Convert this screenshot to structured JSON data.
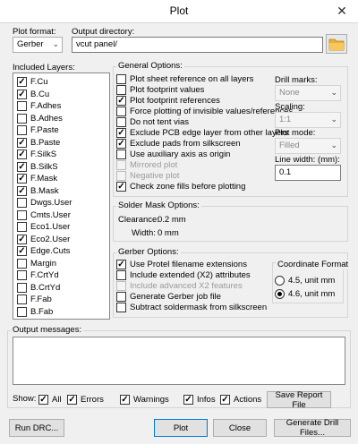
{
  "window": {
    "title": "Plot",
    "close_glyph": "✕"
  },
  "plot_format": {
    "label": "Plot format:",
    "value": "Gerber"
  },
  "output_directory": {
    "label": "Output directory:",
    "value": "vcut panel/",
    "folder_icon": "folder-icon"
  },
  "layers": {
    "label": "Included Layers:",
    "items": [
      {
        "name": "F.Cu",
        "checked": true
      },
      {
        "name": "B.Cu",
        "checked": true
      },
      {
        "name": "F.Adhes",
        "checked": false
      },
      {
        "name": "B.Adhes",
        "checked": false
      },
      {
        "name": "F.Paste",
        "checked": false
      },
      {
        "name": "B.Paste",
        "checked": true
      },
      {
        "name": "F.SilkS",
        "checked": true
      },
      {
        "name": "B.SilkS",
        "checked": true
      },
      {
        "name": "F.Mask",
        "checked": true
      },
      {
        "name": "B.Mask",
        "checked": true
      },
      {
        "name": "Dwgs.User",
        "checked": false
      },
      {
        "name": "Cmts.User",
        "checked": false
      },
      {
        "name": "Eco1.User",
        "checked": false
      },
      {
        "name": "Eco2.User",
        "checked": true
      },
      {
        "name": "Edge.Cuts",
        "checked": true
      },
      {
        "name": "Margin",
        "checked": false
      },
      {
        "name": "F.CrtYd",
        "checked": false
      },
      {
        "name": "B.CrtYd",
        "checked": false
      },
      {
        "name": "F.Fab",
        "checked": false
      },
      {
        "name": "B.Fab",
        "checked": false
      }
    ]
  },
  "general": {
    "label": "General Options:",
    "options": [
      {
        "label": "Plot sheet reference on all layers",
        "checked": false,
        "disabled": false
      },
      {
        "label": "Plot footprint values",
        "checked": false,
        "disabled": false
      },
      {
        "label": "Plot footprint references",
        "checked": true,
        "disabled": false
      },
      {
        "label": "Force plotting of invisible values/references",
        "checked": false,
        "disabled": false
      },
      {
        "label": "Do not tent vias",
        "checked": false,
        "disabled": false
      },
      {
        "label": "Exclude PCB edge layer from other layers",
        "checked": true,
        "disabled": false
      },
      {
        "label": "Exclude pads from silkscreen",
        "checked": true,
        "disabled": false
      },
      {
        "label": "Use auxiliary axis as origin",
        "checked": false,
        "disabled": false
      },
      {
        "label": "Mirrored plot",
        "checked": false,
        "disabled": true
      },
      {
        "label": "Negative plot",
        "checked": false,
        "disabled": true
      },
      {
        "label": "Check zone fills before plotting",
        "checked": true,
        "disabled": false
      }
    ],
    "drill_marks": {
      "label": "Drill marks:",
      "value": "None"
    },
    "scaling": {
      "label": "Scaling:",
      "value": "1:1"
    },
    "plot_mode": {
      "label": "Plot mode:",
      "value": "Filled"
    },
    "line_width": {
      "label": "Line width: (mm):",
      "value": "0.1"
    }
  },
  "solder_mask": {
    "label": "Solder Mask Options:",
    "clearance_label": "Clearance:",
    "clearance_value": "0.2 mm",
    "width_label": "Width:",
    "width_value": "0 mm"
  },
  "gerber": {
    "label": "Gerber Options:",
    "options": [
      {
        "label": "Use Protel filename extensions",
        "checked": true,
        "disabled": false
      },
      {
        "label": "Include extended (X2) attributes",
        "checked": false,
        "disabled": false
      },
      {
        "label": "Include advanced X2 features",
        "checked": false,
        "disabled": true
      },
      {
        "label": "Generate Gerber job file",
        "checked": false,
        "disabled": false
      },
      {
        "label": "Subtract soldermask from silkscreen",
        "checked": false,
        "disabled": false
      }
    ],
    "coordinate_format": {
      "label": "Coordinate Format",
      "options": [
        {
          "label": "4.5, unit mm",
          "selected": false
        },
        {
          "label": "4.6, unit mm",
          "selected": true
        }
      ]
    }
  },
  "messages": {
    "label": "Output messages:"
  },
  "show": {
    "label": "Show:",
    "filters": [
      {
        "label": "All",
        "checked": true
      },
      {
        "label": "Errors",
        "checked": true
      },
      {
        "label": "Warnings",
        "checked": true
      },
      {
        "label": "Infos",
        "checked": true
      },
      {
        "label": "Actions",
        "checked": true
      }
    ],
    "save_report": "Save Report File"
  },
  "buttons": {
    "run_drc": "Run DRC...",
    "plot": "Plot",
    "close": "Close",
    "generate_drill": "Generate Drill Files..."
  }
}
